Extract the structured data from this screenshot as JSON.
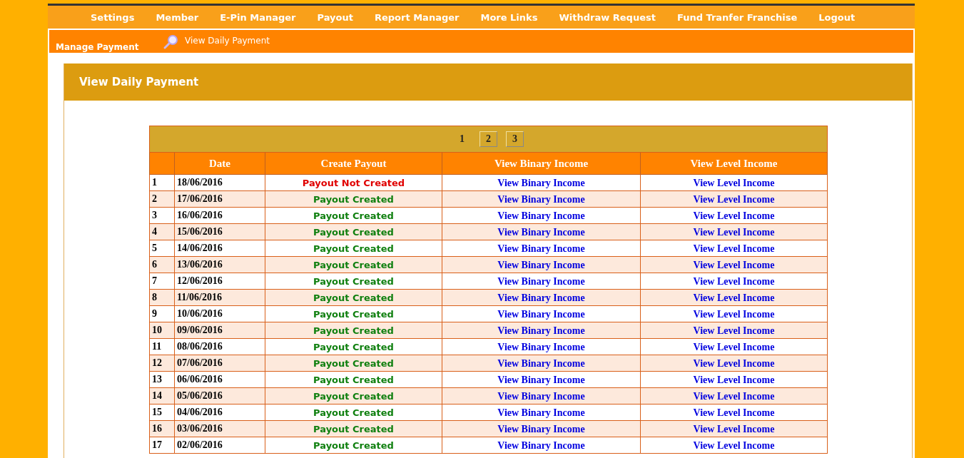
{
  "nav": [
    "Settings",
    "Member",
    "E-Pin Manager",
    "Payout",
    "Report Manager",
    "More Links",
    "Withdraw Request",
    "Fund Tranfer Franchise",
    "Logout"
  ],
  "subbar": {
    "section": "Manage Payment",
    "link": "View Daily Payment"
  },
  "panel": {
    "title": "View Daily Payment"
  },
  "pagination": [
    {
      "label": "1",
      "selected": true
    },
    {
      "label": "2",
      "selected": false
    },
    {
      "label": "3",
      "selected": false
    }
  ],
  "table": {
    "columns": [
      "Date",
      "Create Payout",
      "View Binary Income",
      "View Level Income"
    ],
    "rows": [
      {
        "no": "1",
        "date": "18/06/2016",
        "payout": "Payout Not Created",
        "kind": "not_created",
        "binary": "View Binary Income",
        "level": "View Level Income"
      },
      {
        "no": "2",
        "date": "17/06/2016",
        "payout": "Payout Created",
        "kind": "created",
        "binary": "View Binary Income",
        "level": "View Level Income"
      },
      {
        "no": "3",
        "date": "16/06/2016",
        "payout": "Payout Created",
        "kind": "created",
        "binary": "View Binary Income",
        "level": "View Level Income"
      },
      {
        "no": "4",
        "date": "15/06/2016",
        "payout": "Payout Created",
        "kind": "created",
        "binary": "View Binary Income",
        "level": "View Level Income"
      },
      {
        "no": "5",
        "date": "14/06/2016",
        "payout": "Payout Created",
        "kind": "created",
        "binary": "View Binary Income",
        "level": "View Level Income"
      },
      {
        "no": "6",
        "date": "13/06/2016",
        "payout": "Payout Created",
        "kind": "created",
        "binary": "View Binary Income",
        "level": "View Level Income"
      },
      {
        "no": "7",
        "date": "12/06/2016",
        "payout": "Payout Created",
        "kind": "created",
        "binary": "View Binary Income",
        "level": "View Level Income"
      },
      {
        "no": "8",
        "date": "11/06/2016",
        "payout": "Payout Created",
        "kind": "created",
        "binary": "View Binary Income",
        "level": "View Level Income"
      },
      {
        "no": "9",
        "date": "10/06/2016",
        "payout": "Payout Created",
        "kind": "created",
        "binary": "View Binary Income",
        "level": "View Level Income"
      },
      {
        "no": "10",
        "date": "09/06/2016",
        "payout": "Payout Created",
        "kind": "created",
        "binary": "View Binary Income",
        "level": "View Level Income"
      },
      {
        "no": "11",
        "date": "08/06/2016",
        "payout": "Payout Created",
        "kind": "created",
        "binary": "View Binary Income",
        "level": "View Level Income"
      },
      {
        "no": "12",
        "date": "07/06/2016",
        "payout": "Payout Created",
        "kind": "created",
        "binary": "View Binary Income",
        "level": "View Level Income"
      },
      {
        "no": "13",
        "date": "06/06/2016",
        "payout": "Payout Created",
        "kind": "created",
        "binary": "View Binary Income",
        "level": "View Level Income"
      },
      {
        "no": "14",
        "date": "05/06/2016",
        "payout": "Payout Created",
        "kind": "created",
        "binary": "View Binary Income",
        "level": "View Level Income"
      },
      {
        "no": "15",
        "date": "04/06/2016",
        "payout": "Payout Created",
        "kind": "created",
        "binary": "View Binary Income",
        "level": "View Level Income"
      },
      {
        "no": "16",
        "date": "03/06/2016",
        "payout": "Payout Created",
        "kind": "created",
        "binary": "View Binary Income",
        "level": "View Level Income"
      },
      {
        "no": "17",
        "date": "02/06/2016",
        "payout": "Payout Created",
        "kind": "created",
        "binary": "View Binary Income",
        "level": "View Level Income"
      }
    ]
  }
}
